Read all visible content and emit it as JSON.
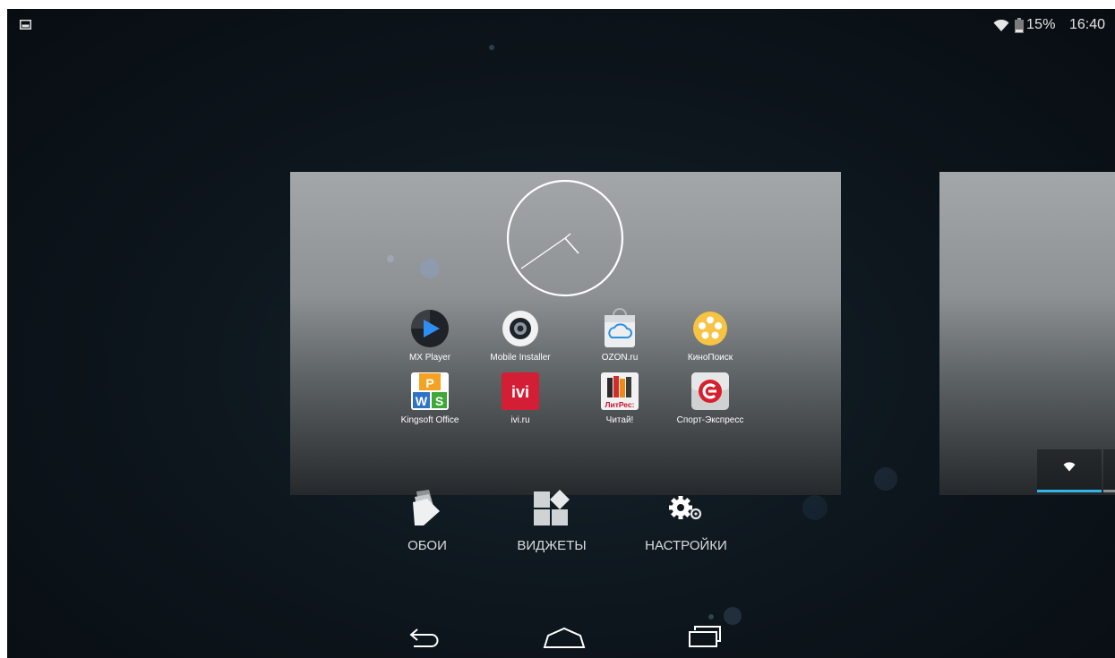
{
  "status_bar": {
    "battery": "15%",
    "time": "16:40",
    "icons": [
      "screenshot-notification-icon",
      "wifi-icon",
      "battery-icon"
    ]
  },
  "home_preview": {
    "widget": "analog-clock",
    "apps": [
      {
        "label": "MX Player",
        "icon": "mx-player-icon"
      },
      {
        "label": "Mobile Installer",
        "icon": "mobile-installer-icon"
      },
      {
        "label": "OZON.ru",
        "icon": "ozon-icon"
      },
      {
        "label": "КиноПоиск",
        "icon": "kinopoisk-icon"
      },
      {
        "label": "Kingsoft Office",
        "icon": "kingsoft-office-icon"
      },
      {
        "label": "ivi.ru",
        "icon": "ivi-icon"
      },
      {
        "label": "Читай!",
        "icon": "litres-icon"
      },
      {
        "label": "Спорт-Экспресс",
        "icon": "sport-express-icon"
      }
    ],
    "litres_icon_text": "ЛитРес:",
    "ivi_icon_text": "ivi"
  },
  "options": {
    "wallpapers": "ОБОИ",
    "widgets": "ВИДЖЕТЫ",
    "settings": "НАСТРОЙКИ"
  },
  "navigation": [
    "back-icon",
    "home-icon",
    "recents-icon"
  ],
  "colors": {
    "accent": "#33b5e5",
    "background": "#0e171e"
  }
}
